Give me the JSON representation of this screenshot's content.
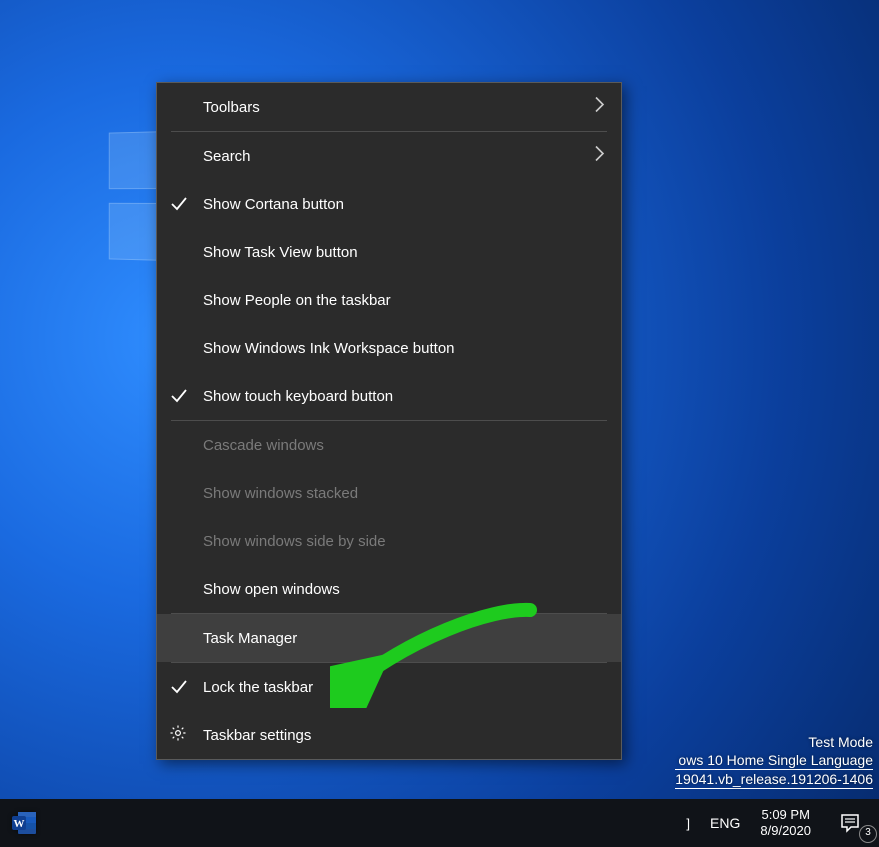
{
  "context_menu": {
    "items": [
      {
        "label": "Toolbars",
        "submenu": true
      },
      {
        "label": "Search",
        "submenu": true
      },
      {
        "label": "Show Cortana button",
        "checked": true
      },
      {
        "label": "Show Task View button"
      },
      {
        "label": "Show People on the taskbar"
      },
      {
        "label": "Show Windows Ink Workspace button"
      },
      {
        "label": "Show touch keyboard button",
        "checked": true
      },
      {
        "label": "Cascade windows",
        "disabled": true
      },
      {
        "label": "Show windows stacked",
        "disabled": true
      },
      {
        "label": "Show windows side by side",
        "disabled": true
      },
      {
        "label": "Show open windows"
      },
      {
        "label": "Task Manager",
        "hovered": true
      },
      {
        "label": "Lock the taskbar",
        "checked": true
      },
      {
        "label": "Taskbar settings",
        "icon": "gear"
      }
    ]
  },
  "watermark": {
    "line1": "Test Mode",
    "line2": "ows 10 Home Single Language",
    "line3": "19041.vb_release.191206-1406"
  },
  "taskbar": {
    "apps": [
      {
        "name": "Word"
      }
    ],
    "tray": {
      "ime_partial": "]",
      "language": "ENG",
      "time": "5:09 PM",
      "date": "8/9/2020",
      "notification_count": "3"
    }
  }
}
